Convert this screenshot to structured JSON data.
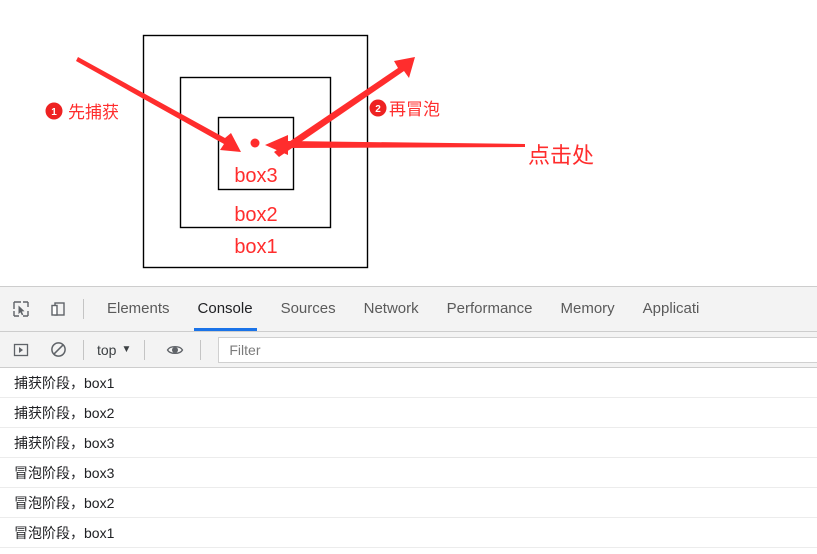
{
  "page": {
    "boxes": [
      {
        "label": "box1"
      },
      {
        "label": "box2"
      },
      {
        "label": "box3"
      }
    ],
    "annotations": [
      {
        "number": "1",
        "text": "先捕获"
      },
      {
        "number": "2",
        "text": "再冒泡"
      }
    ],
    "click_label": "点击处",
    "colors": {
      "annotation_red": "#ff2d2d",
      "box_border": "#000000"
    }
  },
  "devtools": {
    "icons": {
      "inspect": "inspect-element-icon",
      "device": "device-toolbar-icon",
      "sidebar": "console-sidebar-icon",
      "clear": "clear-console-icon",
      "eye": "live-expression-icon"
    },
    "tabs": [
      {
        "label": "Elements",
        "active": false
      },
      {
        "label": "Console",
        "active": true
      },
      {
        "label": "Sources",
        "active": false
      },
      {
        "label": "Network",
        "active": false
      },
      {
        "label": "Performance",
        "active": false
      },
      {
        "label": "Memory",
        "active": false
      },
      {
        "label": "Applicati",
        "active": false
      }
    ],
    "toolbar": {
      "context": "top",
      "filter_placeholder": "Filter",
      "filter_value": ""
    },
    "console_rows": [
      {
        "text": "捕获阶段，box1"
      },
      {
        "text": "捕获阶段，box2"
      },
      {
        "text": "捕获阶段，box3"
      },
      {
        "text": "冒泡阶段，box3"
      },
      {
        "text": "冒泡阶段，box2"
      },
      {
        "text": "冒泡阶段，box1"
      }
    ],
    "accent_color": "#1a73e8"
  }
}
